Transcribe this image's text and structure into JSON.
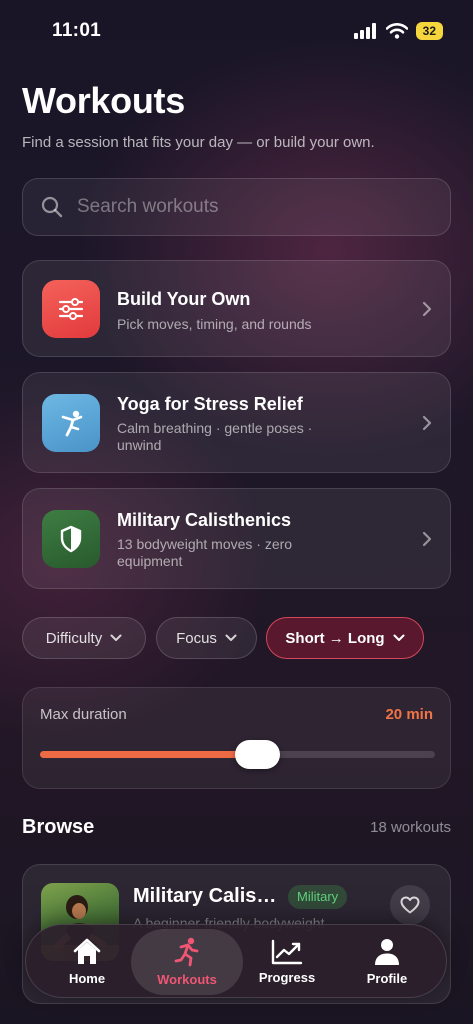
{
  "status": {
    "time": "11:01",
    "battery": "32"
  },
  "header": {
    "title": "Workouts",
    "subtitle": "Find a session that fits your day — or build your own."
  },
  "search": {
    "placeholder": "Search workouts"
  },
  "cards": [
    {
      "title": "Build Your Own",
      "subtitle": "Pick moves, timing, and rounds",
      "icon": "sliders-icon",
      "color": "#ef4a4a"
    },
    {
      "title": "Yoga for Stress Relief",
      "subtitle": "Calm breathing · gentle poses · unwind",
      "icon": "yoga-pose-icon",
      "color": "#5aa9d8"
    },
    {
      "title": "Military Calisthenics",
      "subtitle": "13 bodyweight moves · zero equipment",
      "icon": "shield-icon",
      "color": "#2f6a35"
    }
  ],
  "filters": {
    "difficulty": "Difficulty",
    "focus": "Focus",
    "sort": "Short → Long"
  },
  "duration": {
    "label": "Max duration",
    "value": "20 min",
    "fraction": 0.55
  },
  "browse": {
    "title": "Browse",
    "count": "18 workouts",
    "item": {
      "title": "Military Calisthenics",
      "badge": "Military",
      "description": "A beginner-friendly bodyweight"
    }
  },
  "tabs": [
    {
      "label": "Home",
      "icon": "home-icon",
      "active": false
    },
    {
      "label": "Workouts",
      "icon": "running-icon",
      "active": true
    },
    {
      "label": "Progress",
      "icon": "chart-icon",
      "active": false
    },
    {
      "label": "Profile",
      "icon": "person-icon",
      "active": false
    }
  ],
  "colors": {
    "accent": "#ee6a44",
    "tab_active": "#ee5673",
    "badge": "#5fd07a"
  }
}
